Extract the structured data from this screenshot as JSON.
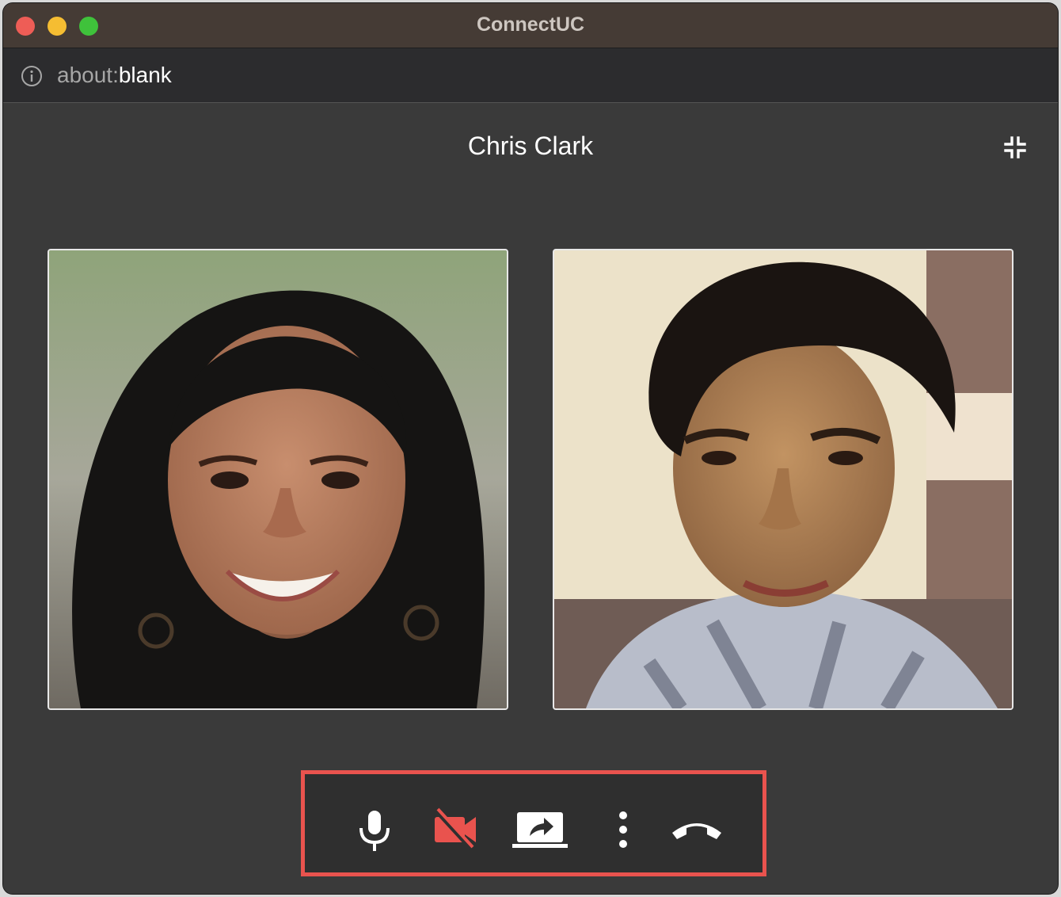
{
  "window": {
    "title": "ConnectUC"
  },
  "urlbar": {
    "scheme": "about:",
    "path": "blank"
  },
  "call": {
    "caller_name": "Chris Clark"
  },
  "colors": {
    "accent_highlight": "#e9534e",
    "camera_off": "#e9534e",
    "icon": "#ffffff",
    "background": "#3a3a3a"
  },
  "icons": {
    "info": "info-icon",
    "collapse": "collapse-icon",
    "mic": "microphone-icon",
    "camera": "camera-off-icon",
    "share": "screen-share-icon",
    "more": "more-vertical-icon",
    "hangup": "phone-hangup-icon"
  }
}
